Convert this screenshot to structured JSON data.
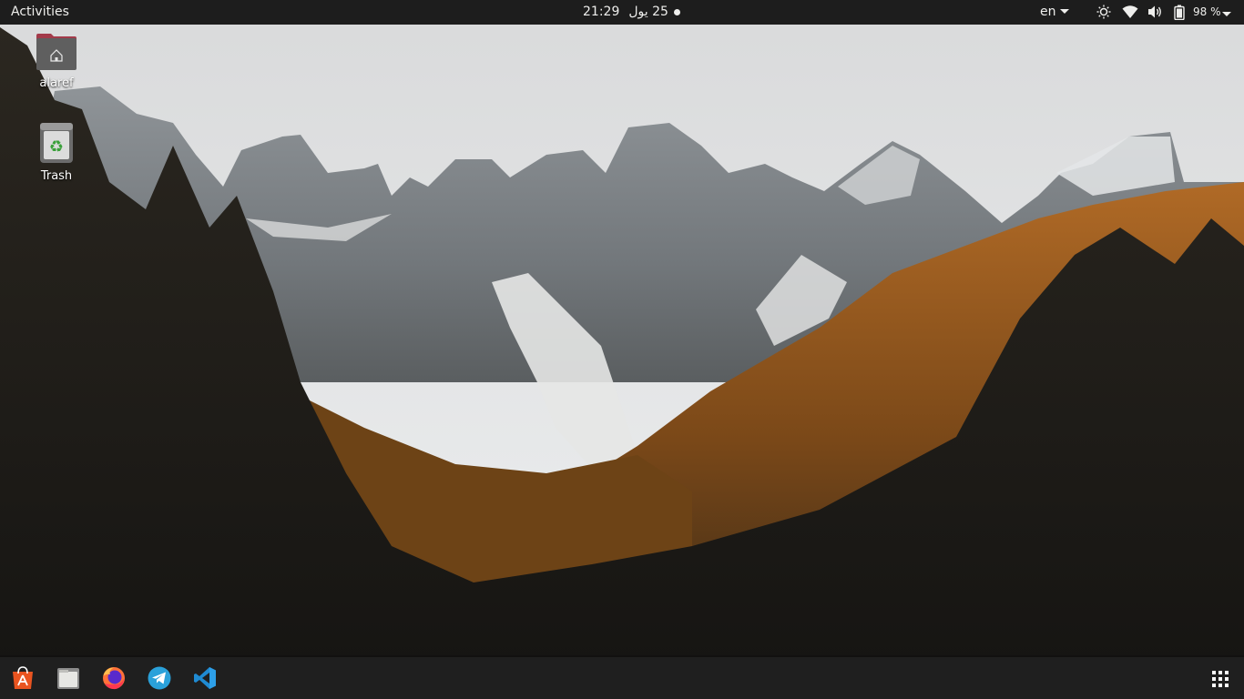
{
  "topbar": {
    "activities": "Activities",
    "clock_time": "21:29",
    "clock_date": "25 يول",
    "language": "en",
    "battery_percent": "98 %"
  },
  "desktop": {
    "icons": [
      {
        "label": "alaref",
        "icon": "home-folder-icon"
      },
      {
        "label": "Trash",
        "icon": "trash-icon"
      }
    ]
  },
  "dock": {
    "items": [
      {
        "name": "Ubuntu Software",
        "icon": "software-center-icon"
      },
      {
        "name": "Files",
        "icon": "files-icon"
      },
      {
        "name": "Firefox",
        "icon": "firefox-icon"
      },
      {
        "name": "Telegram",
        "icon": "telegram-icon"
      },
      {
        "name": "Visual Studio Code",
        "icon": "vscode-icon"
      }
    ],
    "show_apps": "apps-grid-icon"
  },
  "colors": {
    "panel": "#1d1d1d",
    "dock": "#1f1f1f",
    "folder_accent": "#a33a4a",
    "software_orange": "#e95420",
    "telegram_blue": "#2aa1da",
    "vscode_blue": "#1f8ad2"
  }
}
